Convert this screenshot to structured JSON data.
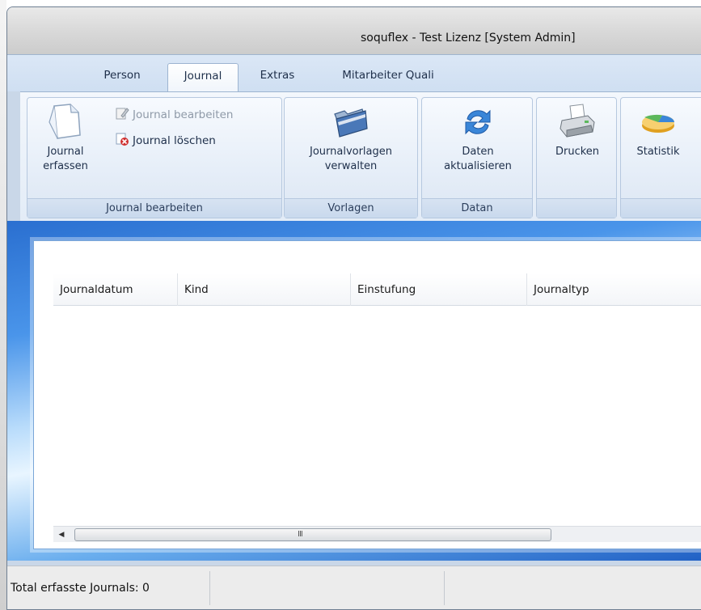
{
  "window": {
    "title": "soquflex - Test Lizenz [System Admin]"
  },
  "tabs": [
    {
      "label": "Person",
      "active": false
    },
    {
      "label": "Journal",
      "active": true
    },
    {
      "label": "Extras",
      "active": false
    },
    {
      "label": "Mitarbeiter Quali",
      "active": false
    }
  ],
  "ribbon": {
    "groups": [
      {
        "label": "Journal bearbeiten",
        "buttons": [
          {
            "label_line1": "Journal",
            "label_line2": "erfassen",
            "icon": "document-icon"
          },
          {
            "label": "Journal bearbeiten",
            "icon": "edit-document-icon",
            "enabled": false
          },
          {
            "label": "Journal löschen",
            "icon": "delete-document-icon",
            "enabled": true
          }
        ]
      },
      {
        "label": "Vorlagen",
        "buttons": [
          {
            "label_line1": "Journalvorlagen",
            "label_line2": "verwalten",
            "icon": "folder-icon"
          }
        ]
      },
      {
        "label": "Datan",
        "buttons": [
          {
            "label_line1": "Daten",
            "label_line2": "aktualisieren",
            "icon": "refresh-icon"
          }
        ]
      },
      {
        "label": "",
        "buttons": [
          {
            "label": "Drucken",
            "icon": "printer-icon"
          }
        ]
      },
      {
        "label": "",
        "buttons": [
          {
            "label": "Statistik",
            "icon": "chart-icon"
          }
        ]
      }
    ]
  },
  "table": {
    "columns": [
      "Journaldatum",
      "Kind",
      "Einstufung",
      "Journaltyp"
    ],
    "rows": []
  },
  "scrollbar": {
    "grip": "III"
  },
  "statusbar": {
    "total_label": "Total erfasste Journals: 0"
  },
  "colors": {
    "accent": "#2a6fd0",
    "ribbon": "#e3ecf7",
    "delete": "#d03030"
  }
}
